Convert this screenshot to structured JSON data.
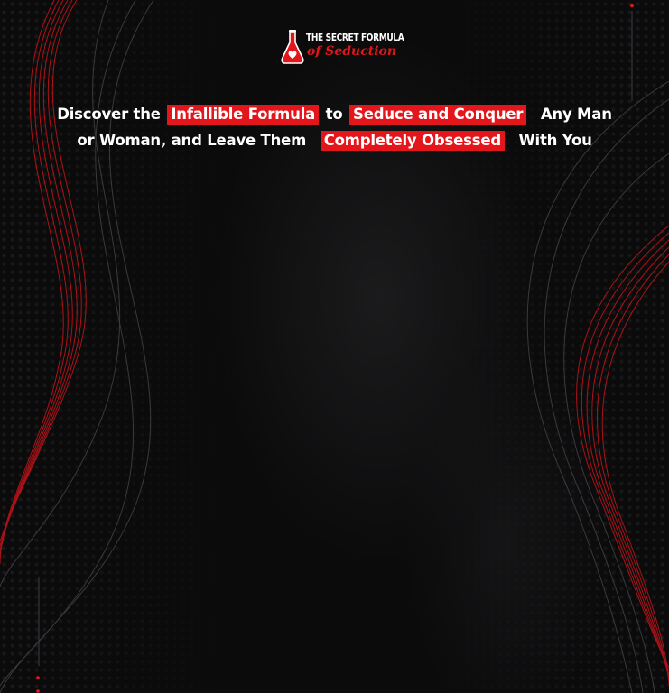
{
  "logo": {
    "line1": "THE SECRET FORMULA",
    "line2": "of Seduction",
    "icon": "flask-heart-icon"
  },
  "headline": {
    "line1": {
      "part1": "Discover the",
      "highlight1": "Infallible Formula",
      "part2": "to",
      "highlight2": "Seduce and Conquer",
      "part3": "Any Man"
    },
    "line2": {
      "part1": "or Woman, and Leave Them",
      "highlight1": "Completely Obsessed",
      "part2": "With You"
    }
  },
  "colors": {
    "background": "#0b0b0c",
    "accent": "#e3161c",
    "text": "#ffffff"
  }
}
